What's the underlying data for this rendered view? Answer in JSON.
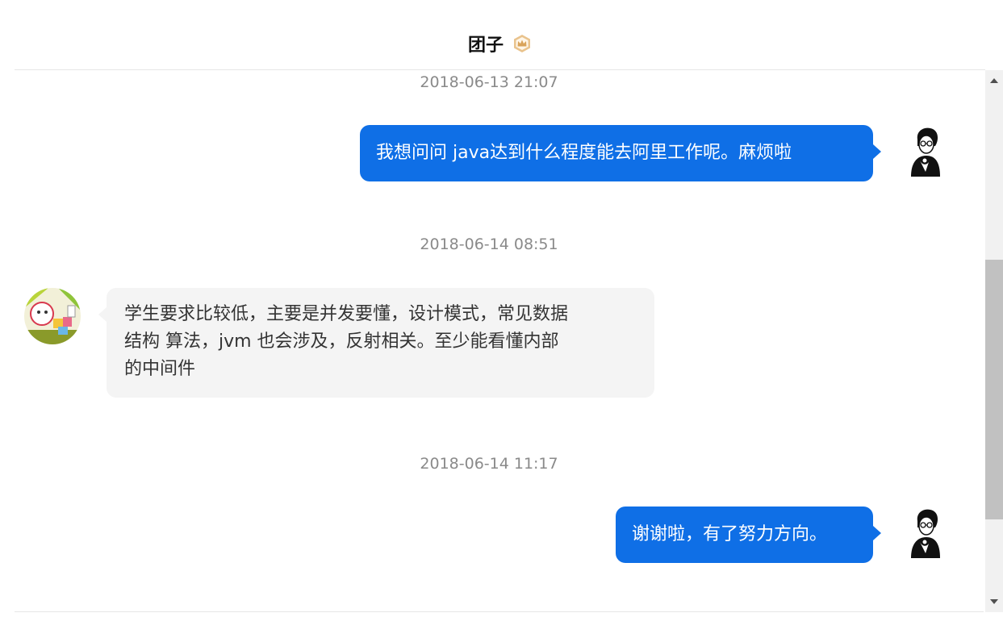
{
  "header": {
    "title": "团子",
    "badge_icon": "crown-icon"
  },
  "messages": [
    {
      "timestamp": "2018-06-13 21:07",
      "direction": "out",
      "text": "我想问问  java达到什么程度能去阿里工作呢。麻烦啦"
    },
    {
      "timestamp": "2018-06-14 08:51",
      "direction": "in",
      "lines": [
        "学生要求比较低，主要是并发要懂，设计模式，常见数据",
        "结构  算法，jvm 也会涉及，反射相关。至少能看懂内部",
        "的中间件"
      ]
    },
    {
      "timestamp": "2018-06-14 11:17",
      "direction": "out",
      "text": "谢谢啦，有了努力方向。"
    }
  ],
  "colors": {
    "outgoing_bubble": "#0f6fe6",
    "incoming_bubble": "#f4f4f4",
    "timestamp": "#8a8a8a",
    "badge": "#d9a35a"
  }
}
